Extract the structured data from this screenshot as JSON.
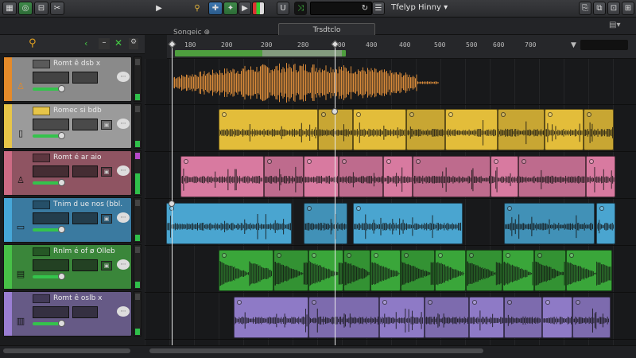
{
  "window": {
    "title": "Tfelyp Hinny"
  },
  "toolbar": {
    "ruler_mode": "Songeic",
    "arrangement_label": "Trsdtclo"
  },
  "ruler": {
    "ticks": [
      "180",
      "200",
      "200",
      "280",
      "300",
      "400",
      "400",
      "500",
      "500",
      "600",
      "700"
    ]
  },
  "tracks": [
    {
      "name": "Romt ê dsb x",
      "color": "#8e8e8e",
      "stripe": "#e48a2a"
    },
    {
      "name": "Romec si bdb",
      "color": "#9d9d9d",
      "stripe": "#e7c548"
    },
    {
      "name": "Romt é ar aio",
      "color": "#9a5a68",
      "stripe": "#cc6b84"
    },
    {
      "name": "Tnim d ue nos (bbl.",
      "color": "#3d7fa6",
      "stripe": "#46a7d8"
    },
    {
      "name": "Rnlm é of ø Olleb",
      "color": "#3d8a3d",
      "stripe": "#47c047"
    },
    {
      "name": "Romt ê oslb x",
      "color": "#6a5d8a",
      "stripe": "#9a7ed3"
    }
  ],
  "colors": {
    "orange": "#d98a3a",
    "yellow": "#e3bd3a",
    "pink": "#d87aa0",
    "blue": "#4aa5d0",
    "green": "#3aa63a",
    "purple": "#8e7ac6"
  }
}
